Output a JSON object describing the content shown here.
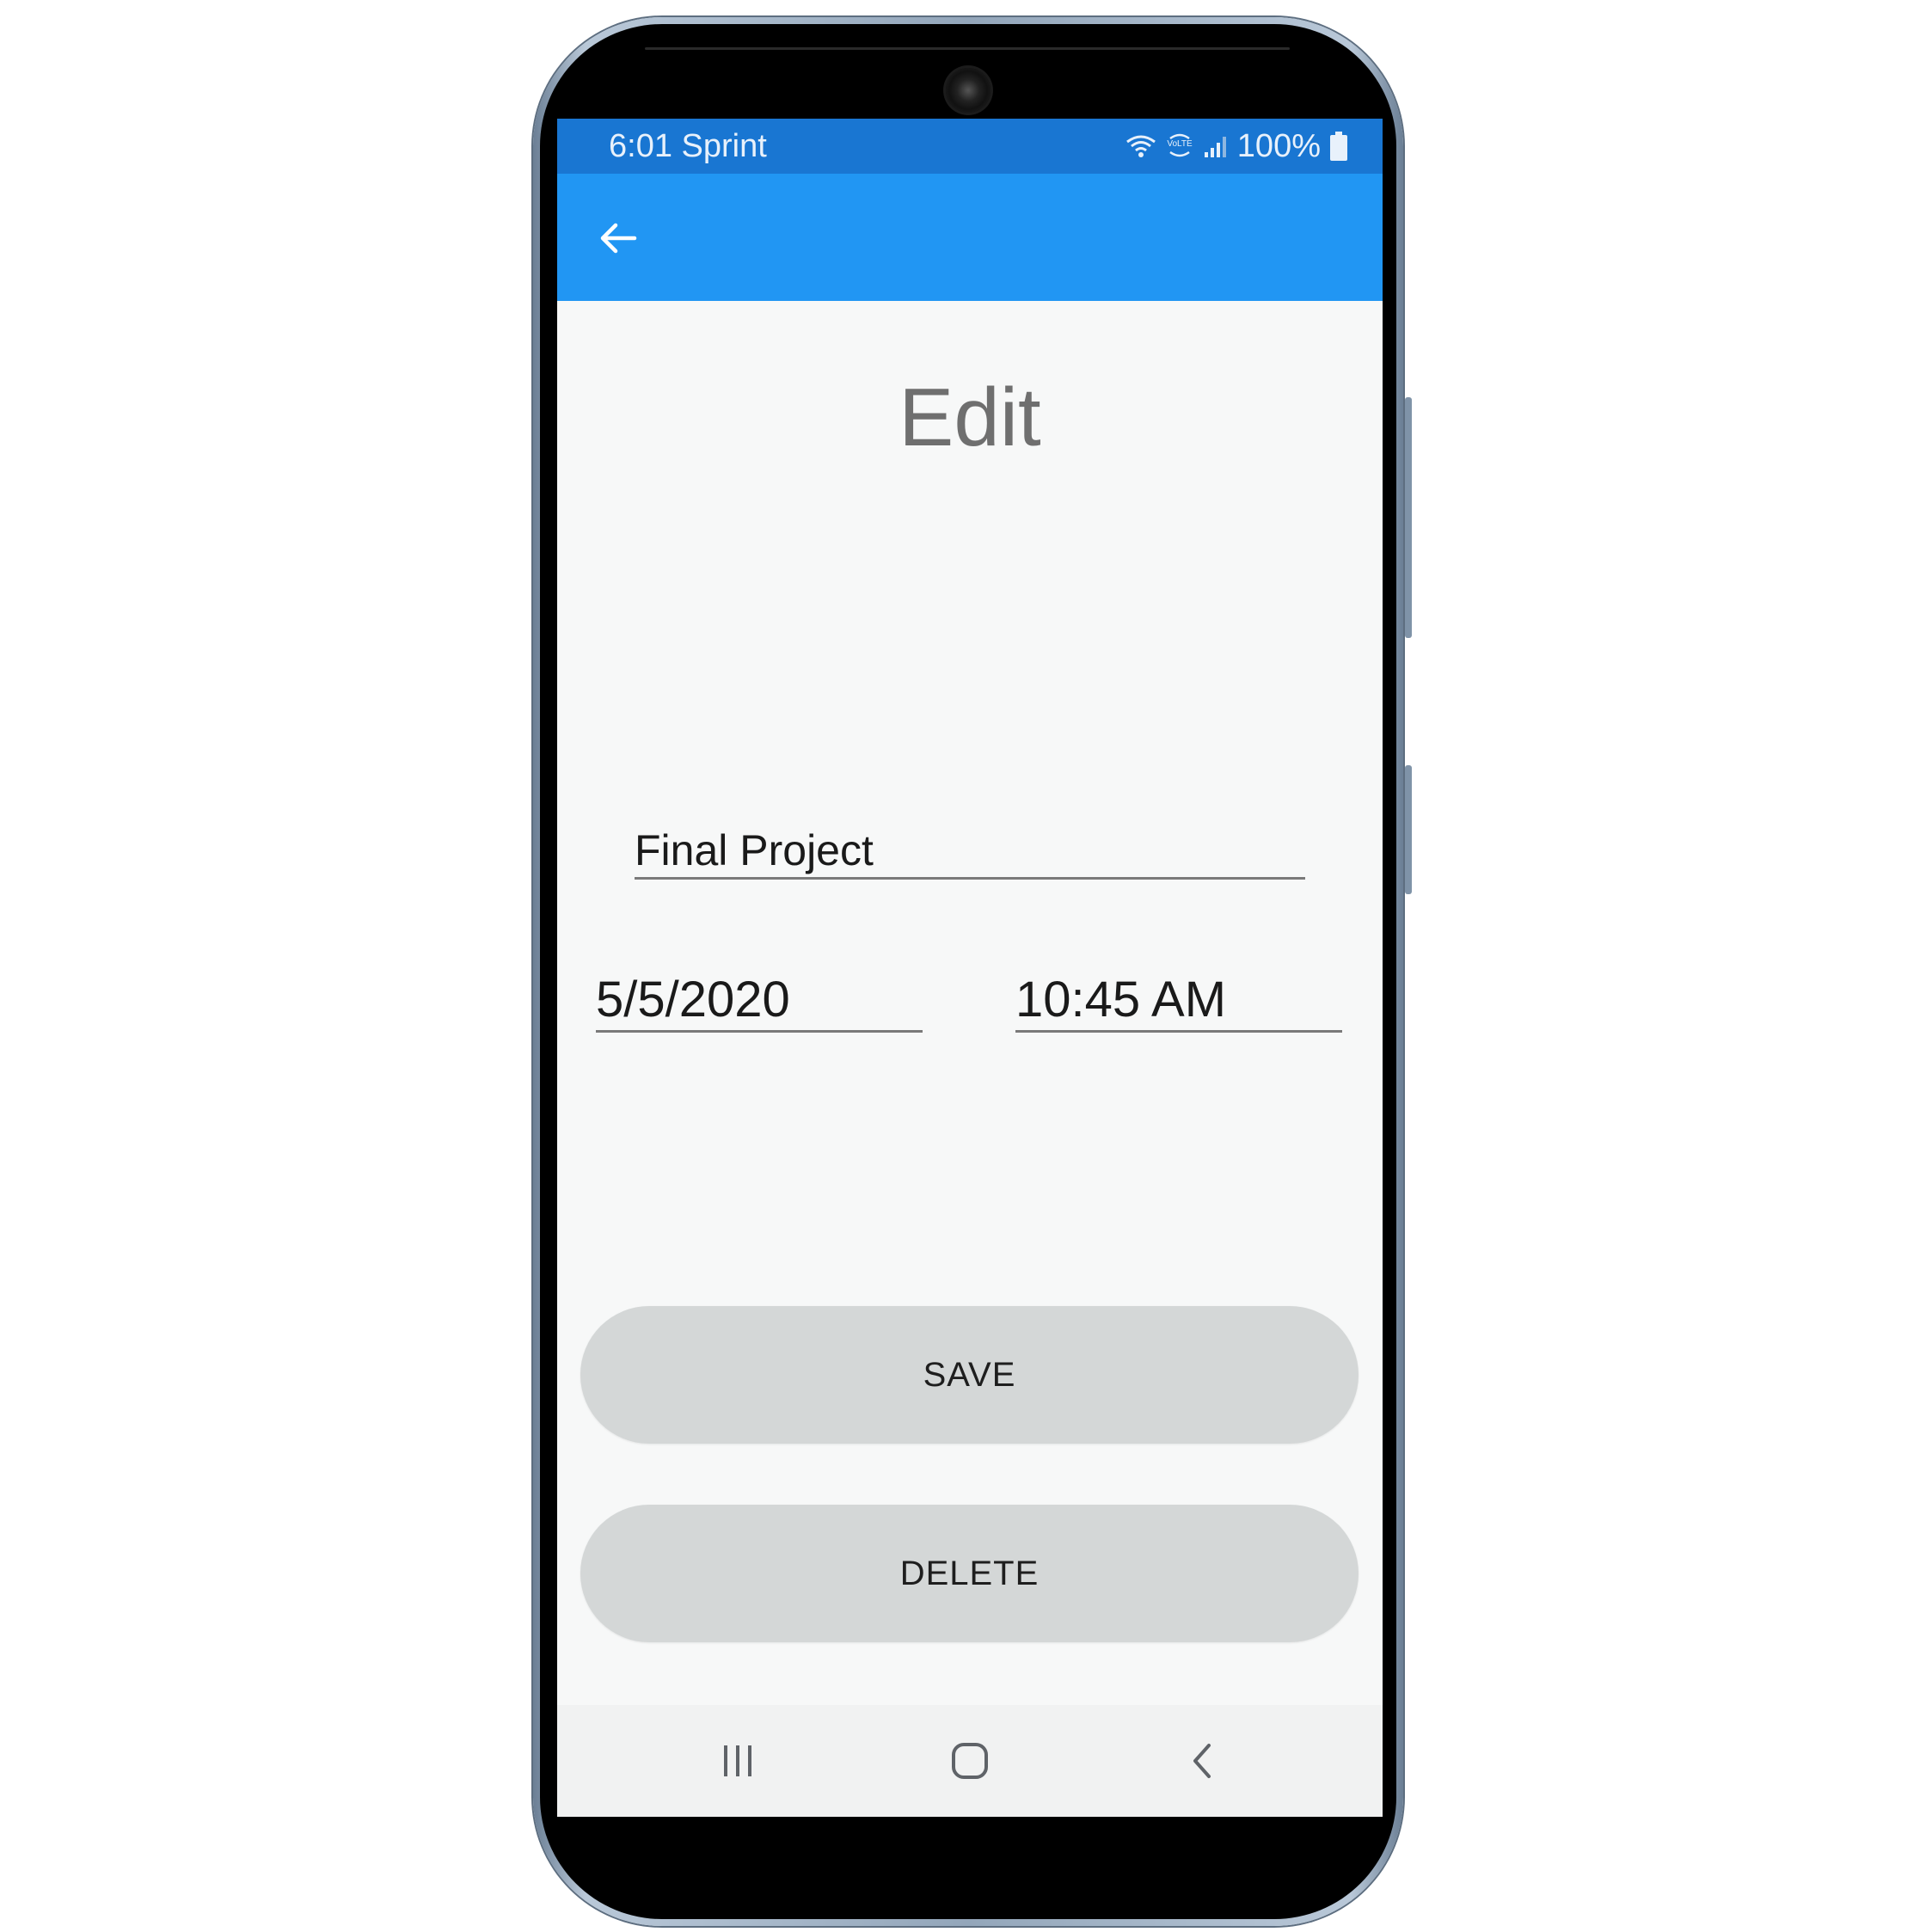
{
  "status_bar": {
    "time_carrier": "6:01 Sprint",
    "battery": "100%",
    "icons": [
      "wifi-icon",
      "volte-icon",
      "signal-icon",
      "battery-icon"
    ]
  },
  "app_bar": {
    "back_icon": "arrow-left-icon",
    "color": "#2196f3",
    "status_color": "#1976d2"
  },
  "page": {
    "title": "Edit"
  },
  "form": {
    "name_value": "Final Project",
    "date_value": "5/5/2020",
    "time_value": "10:45 AM"
  },
  "buttons": {
    "save_label": "SAVE",
    "delete_label": "DELETE"
  },
  "nav_bar": {
    "icons": [
      "recent-apps-icon",
      "home-icon",
      "back-icon"
    ]
  }
}
